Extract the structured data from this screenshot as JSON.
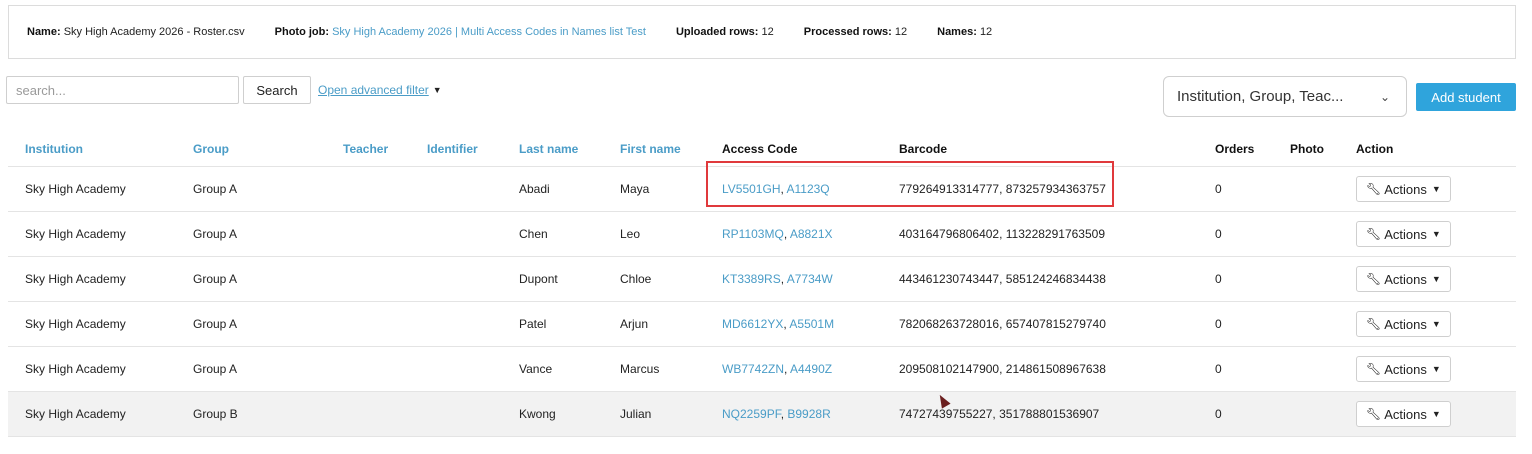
{
  "info": {
    "name_label": "Name:",
    "name_value": "Sky High Academy 2026 - Roster.csv",
    "photo_job_label": "Photo job:",
    "photo_job_value": "Sky High Academy 2026 | Multi Access Codes in Names list Test",
    "uploaded_label": "Uploaded rows:",
    "uploaded_value": "12",
    "processed_label": "Processed rows:",
    "processed_value": "12",
    "names_label": "Names:",
    "names_value": "12"
  },
  "toolbar": {
    "search_placeholder": "search...",
    "search_button": "Search",
    "advanced_filter": "Open advanced filter",
    "column_select_value": "Institution, Group, Teac...",
    "add_student": "Add student"
  },
  "table": {
    "headers": {
      "institution": "Institution",
      "group": "Group",
      "teacher": "Teacher",
      "identifier": "Identifier",
      "last_name": "Last name",
      "first_name": "First name",
      "access_code": "Access Code",
      "barcode": "Barcode",
      "orders": "Orders",
      "photo": "Photo",
      "action": "Action"
    },
    "actions_label": "Actions",
    "rows": [
      {
        "institution": "Sky High Academy",
        "group": "Group A",
        "last": "Abadi",
        "first": "Maya",
        "code1": "LV5501GH",
        "code2": "A1123Q",
        "barcode": "779264913314777, 873257934363757",
        "orders": "0"
      },
      {
        "institution": "Sky High Academy",
        "group": "Group A",
        "last": "Chen",
        "first": "Leo",
        "code1": "RP1103MQ",
        "code2": "A8821X",
        "barcode": "403164796806402, 113228291763509",
        "orders": "0"
      },
      {
        "institution": "Sky High Academy",
        "group": "Group A",
        "last": "Dupont",
        "first": "Chloe",
        "code1": "KT3389RS",
        "code2": "A7734W",
        "barcode": "443461230743447, 585124246834438",
        "orders": "0"
      },
      {
        "institution": "Sky High Academy",
        "group": "Group A",
        "last": "Patel",
        "first": "Arjun",
        "code1": "MD6612YX",
        "code2": "A5501M",
        "barcode": "782068263728016, 657407815279740",
        "orders": "0"
      },
      {
        "institution": "Sky High Academy",
        "group": "Group A",
        "last": "Vance",
        "first": "Marcus",
        "code1": "WB7742ZN",
        "code2": "A4490Z",
        "barcode": "209508102147900, 214861508967638",
        "orders": "0"
      },
      {
        "institution": "Sky High Academy",
        "group": "Group B",
        "last": "Kwong",
        "first": "Julian",
        "code1": "NQ2259PF",
        "code2": "B9928R",
        "barcode": "74727439755227, 351788801536907",
        "orders": "0"
      }
    ]
  },
  "colors": {
    "accent": "#2fa4dc",
    "link": "#4a9cc7",
    "highlight": "#e0393c"
  }
}
